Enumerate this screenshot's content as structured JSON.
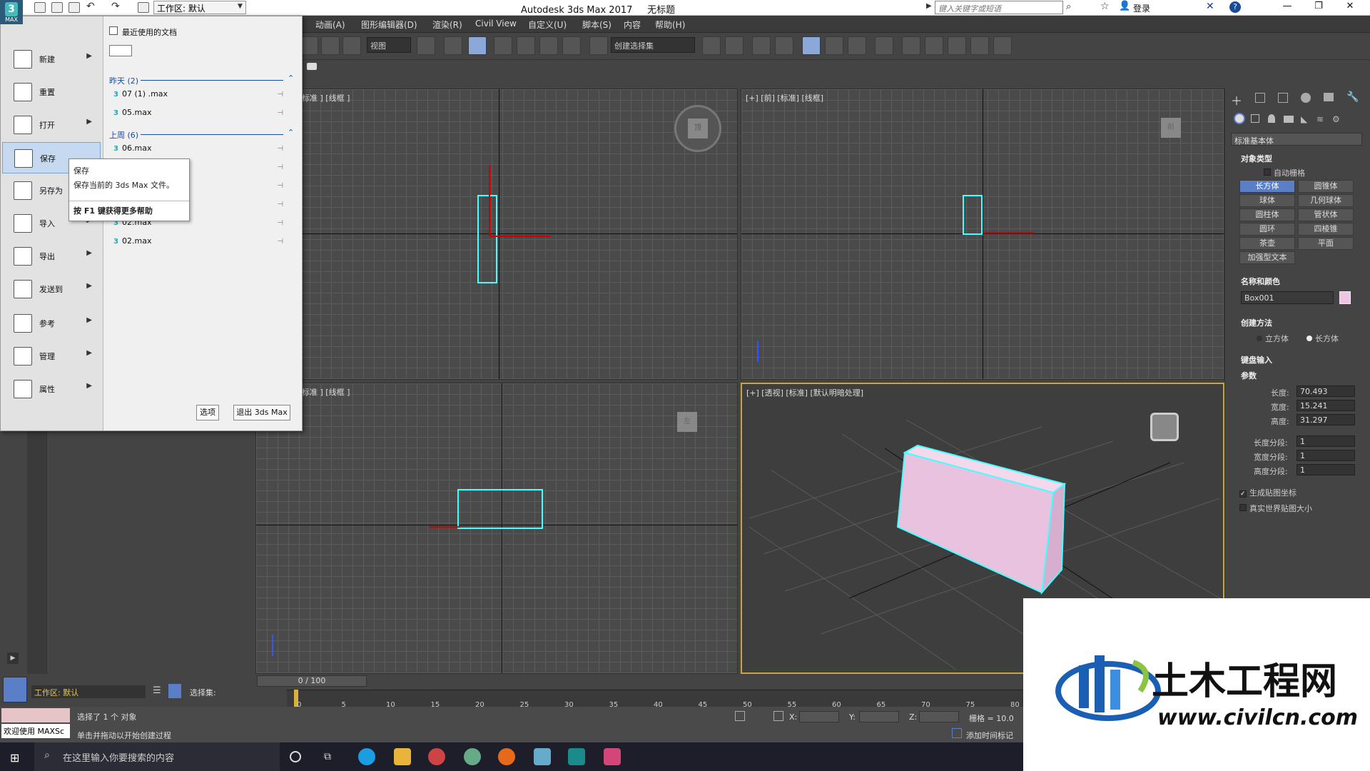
{
  "titlebar": {
    "app_title": "Autodesk 3ds Max 2017",
    "doc_title": "无标题",
    "workspace": "工作区: 默认",
    "search_placeholder": "键入关键字或短语",
    "login": "登录"
  },
  "app_logo": "MAX",
  "menubar": {
    "items": [
      "动画(A)",
      "图形编辑器(D)",
      "渲染(R)",
      "Civil View",
      "自定义(U)",
      "脚本(S)",
      "内容",
      "帮助(H)"
    ]
  },
  "toolbar": {
    "view_combo": "视图",
    "selection_set_combo": "创建选择集"
  },
  "app_menu": {
    "items": [
      {
        "label": "新建",
        "icon": "new-icon",
        "submenu": true
      },
      {
        "label": "重置",
        "icon": "reset-icon",
        "submenu": false
      },
      {
        "label": "打开",
        "icon": "open-icon",
        "submenu": true
      },
      {
        "label": "保存",
        "icon": "save-icon",
        "submenu": false
      },
      {
        "label": "另存为",
        "icon": "save-as-icon",
        "submenu": true
      },
      {
        "label": "导入",
        "icon": "import-icon",
        "submenu": true
      },
      {
        "label": "导出",
        "icon": "export-icon",
        "submenu": true
      },
      {
        "label": "发送到",
        "icon": "send-to-icon",
        "submenu": true
      },
      {
        "label": "参考",
        "icon": "reference-icon",
        "submenu": true
      },
      {
        "label": "管理",
        "icon": "manage-icon",
        "submenu": true
      },
      {
        "label": "属性",
        "icon": "properties-icon",
        "submenu": true
      }
    ],
    "recent_title": "最近使用的文档",
    "groups": [
      {
        "label": "昨天 (2)",
        "files": [
          "07 (1) .max",
          "05.max"
        ]
      },
      {
        "label": "上周 (6)",
        "files": [
          "06.max",
          "",
          "",
          "",
          "02.max",
          "02.max"
        ]
      }
    ],
    "options_button": "选项",
    "exit_button": "退出 3ds Max"
  },
  "tooltip": {
    "title": "保存",
    "description": "保存当前的 3ds Max 文件。",
    "help": "按 F1 键获得更多帮助"
  },
  "viewports": {
    "top": "[+] [顶] [标准] [线框]",
    "front": "[+] [前] [标准] [线框]",
    "left": "[+] [左] [标准] [线框]",
    "perspective": "[+] [透视] [标准] [默认明暗处理]",
    "top_visible": "标准 ] [线框 ]",
    "front_visible": "[+] [前] [标准] [线框]",
    "left_visible": "标准 ] [线框 ]",
    "cube_labels": {
      "top": "顶",
      "front": "前",
      "left": "左"
    }
  },
  "command_panel": {
    "category": "标准基本体",
    "object_type_title": "对象类型",
    "autogrid": "自动栅格",
    "buttons": [
      "长方体",
      "圆锥体",
      "球体",
      "几何球体",
      "圆柱体",
      "管状体",
      "圆环",
      "四棱锥",
      "茶壶",
      "平面",
      "加强型文本"
    ],
    "selected_button": "长方体",
    "name_color_title": "名称和颜色",
    "object_name": "Box001",
    "object_color": "#f1c4e6",
    "creation_method_title": "创建方法",
    "creation_methods": [
      "立方体",
      "长方体"
    ],
    "creation_method_selected": "长方体",
    "keyboard_entry_title": "键盘输入",
    "params_title": "参数",
    "params": [
      {
        "label": "长度:",
        "value": "70.493"
      },
      {
        "label": "宽度:",
        "value": "15.241"
      },
      {
        "label": "高度:",
        "value": "31.297"
      },
      {
        "label": "长度分段:",
        "value": "1"
      },
      {
        "label": "宽度分段:",
        "value": "1"
      },
      {
        "label": "高度分段:",
        "value": "1"
      }
    ],
    "gen_mapping": "生成贴图坐标",
    "real_world": "真实世界贴图大小"
  },
  "timeline": {
    "frame_display": "0 / 100",
    "ticks": [
      "0",
      "5",
      "10",
      "15",
      "20",
      "25",
      "30",
      "35",
      "40",
      "45",
      "50",
      "55",
      "60",
      "65",
      "70",
      "75",
      "80"
    ]
  },
  "status": {
    "workspace_bottom": "工作区: 默认",
    "selection_set_label": "选择集:",
    "maxscript": "欢迎使用 MAXSc",
    "selected_text": "选择了 1 个 对象",
    "hint_text": "单击并拖动以开始创建过程",
    "x_label": "X:",
    "y_label": "Y:",
    "z_label": "Z:",
    "grid": "栅格 = 10.0",
    "add_time_tag": "添加时间标记"
  },
  "taskbar": {
    "search_placeholder": "在这里输入你要搜索的内容"
  },
  "watermark": {
    "brand": "土木工程网",
    "url": "www.civilcn.com"
  }
}
